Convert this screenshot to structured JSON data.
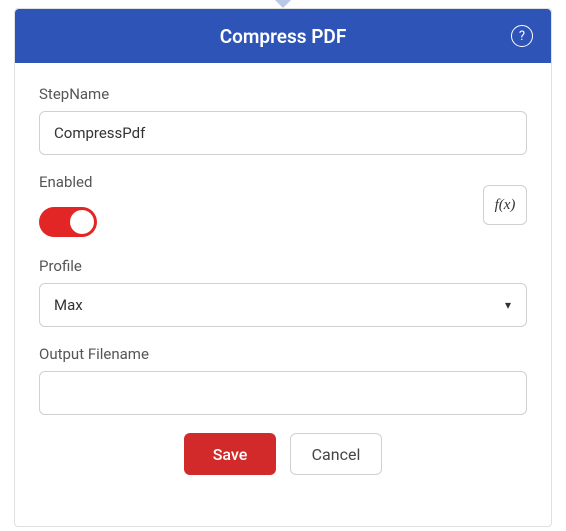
{
  "header": {
    "title": "Compress PDF"
  },
  "fields": {
    "stepname": {
      "label": "StepName",
      "value": "CompressPdf"
    },
    "enabled": {
      "label": "Enabled",
      "on": true
    },
    "fx": {
      "label": "f(x)"
    },
    "profile": {
      "label": "Profile",
      "value": "Max"
    },
    "output": {
      "label": "Output Filename",
      "value": ""
    }
  },
  "buttons": {
    "save": "Save",
    "cancel": "Cancel"
  }
}
